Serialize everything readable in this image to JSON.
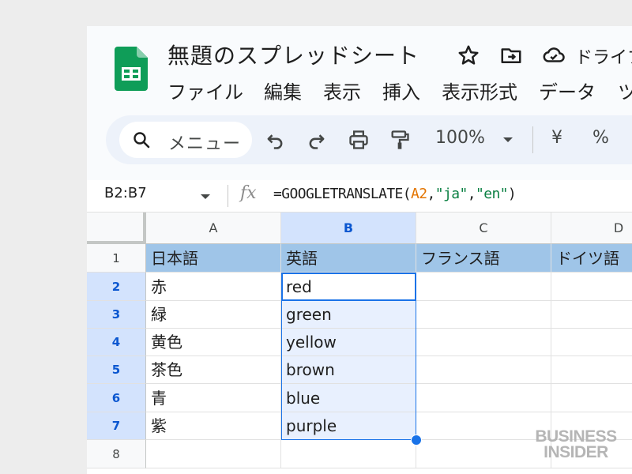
{
  "app": {
    "doc_title": "無題のスプレッドシート",
    "drive_label": "ドライブ",
    "menu": [
      "ファイル",
      "編集",
      "表示",
      "挿入",
      "表示形式",
      "データ",
      "ツ"
    ]
  },
  "toolbar": {
    "search_label": "メニュー",
    "zoom": "100%",
    "currency": "¥",
    "percent": "%"
  },
  "formula_bar": {
    "name_box": "B2:B7",
    "fx": "fx",
    "formula_prefix": "=GOOGLETRANSLATE(",
    "formula_ref": "A2",
    "formula_comma1": ",",
    "formula_src": "\"ja\"",
    "formula_comma2": ",",
    "formula_dst": "\"en\"",
    "formula_suffix": ")"
  },
  "sheet": {
    "columns": [
      "A",
      "B",
      "C",
      "D"
    ],
    "rows": [
      "1",
      "2",
      "3",
      "4",
      "5",
      "6",
      "7",
      "8"
    ],
    "headers": [
      "日本語",
      "英語",
      "フランス語",
      "ドイツ語"
    ],
    "data": [
      [
        "赤",
        "red"
      ],
      [
        "緑",
        "green"
      ],
      [
        "黄色",
        "yellow"
      ],
      [
        "茶色",
        "brown"
      ],
      [
        "青",
        "blue"
      ],
      [
        "紫",
        "purple"
      ]
    ]
  },
  "watermark": {
    "line1": "BUSINESS",
    "line2": "INSIDER"
  },
  "colors": {
    "header_fill": "#9fc5e8",
    "selection": "#1a73e8",
    "sheets_green": "#0f9d58"
  }
}
